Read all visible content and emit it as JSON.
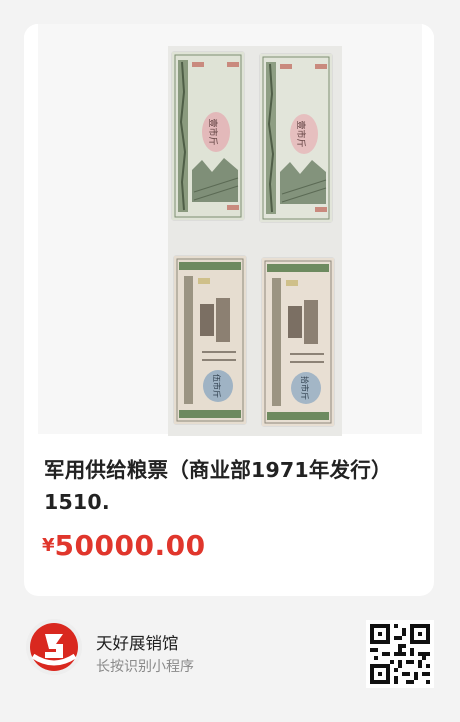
{
  "product": {
    "title": "军用供给粮票（商业部1971年发行）1510.",
    "currency_symbol": "¥",
    "price": "50000.00",
    "image_icon": "ration-coupons-photo"
  },
  "shop": {
    "name": "天好展销馆",
    "subtitle": "长按识别小程序",
    "logo_icon": "shop-logo-icon",
    "qr_icon": "mini-program-qr-code"
  },
  "colors": {
    "price": "#e0362c",
    "background": "#f3f3f3",
    "card": "#ffffff",
    "logo": "#d9281f"
  }
}
